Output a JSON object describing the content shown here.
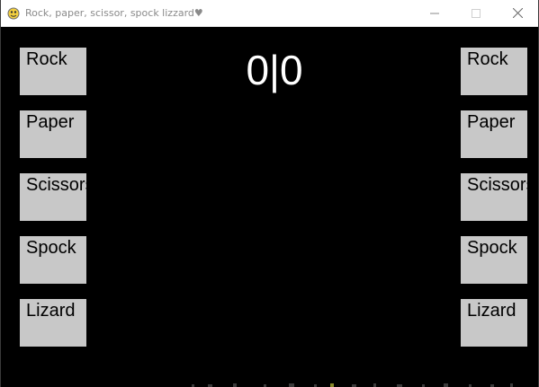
{
  "window": {
    "title": "Rock, paper, scissor, spock lizzard♥",
    "icon": "pygame-snake-icon",
    "controls": [
      "minimize-icon",
      "maximize-icon",
      "close-icon"
    ]
  },
  "game": {
    "score": "0|0",
    "left_choices": [
      "Rock",
      "Paper",
      "Scissors",
      "Spock",
      "Lizard"
    ],
    "right_choices": [
      "Rock",
      "Paper",
      "Scissors",
      "Spock",
      "Lizard"
    ]
  },
  "colors": {
    "background": "#000000",
    "button": "#c8c8c8",
    "score_text": "#ffffff",
    "button_text": "#000000"
  }
}
